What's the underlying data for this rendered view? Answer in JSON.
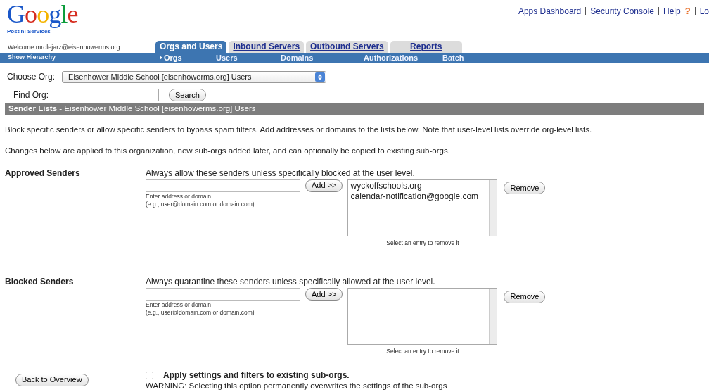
{
  "logo": {
    "wordmark": "Google",
    "subtitle": "Postini Services"
  },
  "top_links": [
    "Apps Dashboard",
    "Security Console",
    "Help",
    "Lo"
  ],
  "help_mark": "?",
  "welcome": "Welcome mrolejarz@eisenhowerms.org",
  "tabs": [
    {
      "label": "Orgs and Users",
      "selected": true
    },
    {
      "label": "Inbound Servers",
      "selected": false
    },
    {
      "label": "Outbound Servers",
      "selected": false
    },
    {
      "label": "Reports",
      "selected": false
    }
  ],
  "subnav": {
    "left": "Show Hierarchy",
    "items": [
      {
        "label": "Orgs",
        "selected": true
      },
      {
        "label": "Users",
        "selected": false
      },
      {
        "label": "Domains",
        "selected": false
      },
      {
        "label": "Authorizations",
        "selected": false
      },
      {
        "label": "Batch",
        "selected": false
      }
    ]
  },
  "choose_org": {
    "label": "Choose Org:",
    "value": "Eisenhower Middle School [eisenhowerms.org] Users"
  },
  "find_org": {
    "label": "Find Org:",
    "button": "Search"
  },
  "section_header": {
    "title": "Sender Lists",
    "subtitle": " - Eisenhower Middle School [eisenhowerms.org] Users"
  },
  "intro": [
    "Block specific senders or allow specific senders to bypass spam filters. Add addresses or domains to the lists below. Note that user-level lists override org-level lists.",
    "Changes below are applied to this organization, new sub-orgs added later, and can optionally be copied to existing sub-orgs."
  ],
  "lists": [
    {
      "label": "Approved Senders",
      "description": "Always allow these senders unless specifically blocked at the user level.",
      "add_button": "Add >>",
      "hint": [
        "Enter address or domain",
        "(e.g., user@domain.com or domain.com)"
      ],
      "entries": [
        "wyckoffschools.org",
        "calendar-notification@google.com"
      ],
      "remove_button": "Remove",
      "caption": "Select an entry to remove it"
    },
    {
      "label": "Blocked Senders",
      "description": "Always quarantine these senders unless specifically allowed at the user level.",
      "add_button": "Add >>",
      "hint": [
        "Enter address or domain",
        "(e.g., user@domain.com or domain.com)"
      ],
      "remove_button": "Remove",
      "caption": "Select an entry to remove it"
    }
  ],
  "back_button": "Back to Overview",
  "apply": {
    "label": "Apply settings and filters to existing sub-orgs.",
    "checked": false,
    "warning": "WARNING: Selecting this option permanently overwrites the settings of the sub-orgs"
  }
}
